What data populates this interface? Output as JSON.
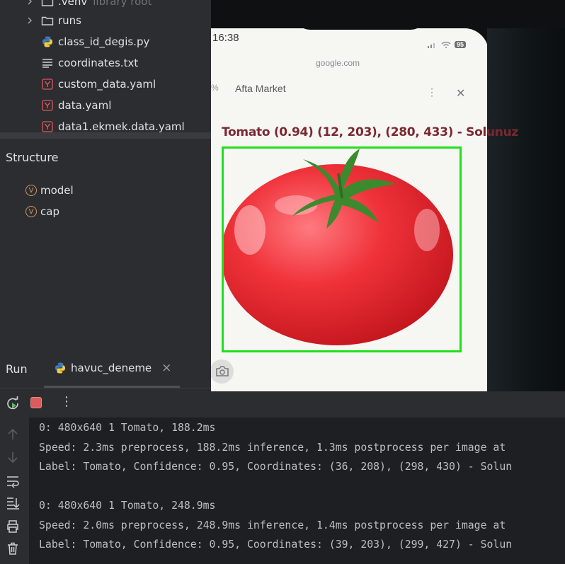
{
  "project_tree": {
    "items": [
      {
        "label": ".venv",
        "suffix": "library root",
        "kind": "folder"
      },
      {
        "label": "runs",
        "kind": "folder"
      },
      {
        "label": "class_id_degis.py",
        "kind": "python"
      },
      {
        "label": "coordinates.txt",
        "kind": "text"
      },
      {
        "label": "custom_data.yaml",
        "kind": "yaml"
      },
      {
        "label": "data.yaml",
        "kind": "yaml"
      },
      {
        "label": "data1.ekmek.data.yaml",
        "kind": "yaml"
      }
    ]
  },
  "structure": {
    "title": "Structure",
    "items": [
      {
        "label": "model",
        "badge": "V"
      },
      {
        "label": "cap",
        "badge": "V"
      }
    ]
  },
  "run": {
    "title": "Run",
    "tab_label": "havuc_deneme",
    "close_glyph": "×",
    "more_glyph": "⋮"
  },
  "console": {
    "lines": [
      "0: 480x640 1 Tomato, 188.2ms",
      "Speed: 2.3ms preprocess, 188.2ms inference, 1.3ms postprocess per image at",
      "Label: Tomato, Confidence: 0.95, Coordinates: (36, 208), (298, 430) - Solun",
      "",
      "0: 480x640 1 Tomato, 248.9ms",
      "Speed: 2.0ms preprocess, 248.9ms inference, 1.4ms postprocess per image at",
      "Label: Tomato, Confidence: 0.95, Coordinates: (39, 203), (299, 427) - Solun"
    ]
  },
  "camera": {
    "phone_time": "16:38",
    "battery": "95",
    "browser_url": "google.com",
    "page_title": "Afta Market",
    "detection_label": "Tomato (0.94) (12, 203), (280, 433) - Solunuz",
    "box_color": "#1fe01a",
    "label_color": "#7a2830"
  },
  "colors": {
    "ide_panel": "#2b2d30",
    "ide_editor": "#1e1f22",
    "text": "#dfe1e5",
    "stop_red": "#db5c5c",
    "rerun_green": "#5fb865"
  }
}
